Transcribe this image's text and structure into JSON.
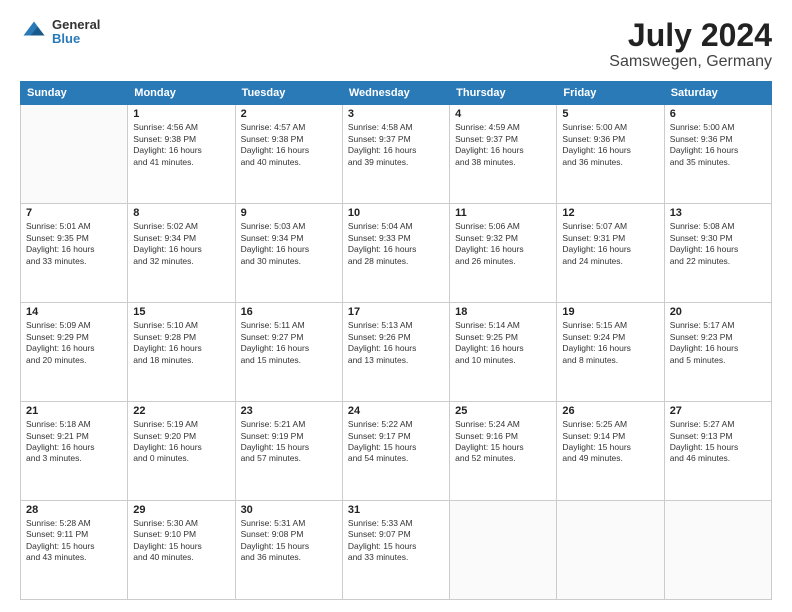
{
  "logo": {
    "line1": "General",
    "line2": "Blue"
  },
  "title": "July 2024",
  "subtitle": "Samswegen, Germany",
  "weekdays": [
    "Sunday",
    "Monday",
    "Tuesday",
    "Wednesday",
    "Thursday",
    "Friday",
    "Saturday"
  ],
  "weeks": [
    [
      {
        "day": "",
        "info": ""
      },
      {
        "day": "1",
        "info": "Sunrise: 4:56 AM\nSunset: 9:38 PM\nDaylight: 16 hours\nand 41 minutes."
      },
      {
        "day": "2",
        "info": "Sunrise: 4:57 AM\nSunset: 9:38 PM\nDaylight: 16 hours\nand 40 minutes."
      },
      {
        "day": "3",
        "info": "Sunrise: 4:58 AM\nSunset: 9:37 PM\nDaylight: 16 hours\nand 39 minutes."
      },
      {
        "day": "4",
        "info": "Sunrise: 4:59 AM\nSunset: 9:37 PM\nDaylight: 16 hours\nand 38 minutes."
      },
      {
        "day": "5",
        "info": "Sunrise: 5:00 AM\nSunset: 9:36 PM\nDaylight: 16 hours\nand 36 minutes."
      },
      {
        "day": "6",
        "info": "Sunrise: 5:00 AM\nSunset: 9:36 PM\nDaylight: 16 hours\nand 35 minutes."
      }
    ],
    [
      {
        "day": "7",
        "info": "Sunrise: 5:01 AM\nSunset: 9:35 PM\nDaylight: 16 hours\nand 33 minutes."
      },
      {
        "day": "8",
        "info": "Sunrise: 5:02 AM\nSunset: 9:34 PM\nDaylight: 16 hours\nand 32 minutes."
      },
      {
        "day": "9",
        "info": "Sunrise: 5:03 AM\nSunset: 9:34 PM\nDaylight: 16 hours\nand 30 minutes."
      },
      {
        "day": "10",
        "info": "Sunrise: 5:04 AM\nSunset: 9:33 PM\nDaylight: 16 hours\nand 28 minutes."
      },
      {
        "day": "11",
        "info": "Sunrise: 5:06 AM\nSunset: 9:32 PM\nDaylight: 16 hours\nand 26 minutes."
      },
      {
        "day": "12",
        "info": "Sunrise: 5:07 AM\nSunset: 9:31 PM\nDaylight: 16 hours\nand 24 minutes."
      },
      {
        "day": "13",
        "info": "Sunrise: 5:08 AM\nSunset: 9:30 PM\nDaylight: 16 hours\nand 22 minutes."
      }
    ],
    [
      {
        "day": "14",
        "info": "Sunrise: 5:09 AM\nSunset: 9:29 PM\nDaylight: 16 hours\nand 20 minutes."
      },
      {
        "day": "15",
        "info": "Sunrise: 5:10 AM\nSunset: 9:28 PM\nDaylight: 16 hours\nand 18 minutes."
      },
      {
        "day": "16",
        "info": "Sunrise: 5:11 AM\nSunset: 9:27 PM\nDaylight: 16 hours\nand 15 minutes."
      },
      {
        "day": "17",
        "info": "Sunrise: 5:13 AM\nSunset: 9:26 PM\nDaylight: 16 hours\nand 13 minutes."
      },
      {
        "day": "18",
        "info": "Sunrise: 5:14 AM\nSunset: 9:25 PM\nDaylight: 16 hours\nand 10 minutes."
      },
      {
        "day": "19",
        "info": "Sunrise: 5:15 AM\nSunset: 9:24 PM\nDaylight: 16 hours\nand 8 minutes."
      },
      {
        "day": "20",
        "info": "Sunrise: 5:17 AM\nSunset: 9:23 PM\nDaylight: 16 hours\nand 5 minutes."
      }
    ],
    [
      {
        "day": "21",
        "info": "Sunrise: 5:18 AM\nSunset: 9:21 PM\nDaylight: 16 hours\nand 3 minutes."
      },
      {
        "day": "22",
        "info": "Sunrise: 5:19 AM\nSunset: 9:20 PM\nDaylight: 16 hours\nand 0 minutes."
      },
      {
        "day": "23",
        "info": "Sunrise: 5:21 AM\nSunset: 9:19 PM\nDaylight: 15 hours\nand 57 minutes."
      },
      {
        "day": "24",
        "info": "Sunrise: 5:22 AM\nSunset: 9:17 PM\nDaylight: 15 hours\nand 54 minutes."
      },
      {
        "day": "25",
        "info": "Sunrise: 5:24 AM\nSunset: 9:16 PM\nDaylight: 15 hours\nand 52 minutes."
      },
      {
        "day": "26",
        "info": "Sunrise: 5:25 AM\nSunset: 9:14 PM\nDaylight: 15 hours\nand 49 minutes."
      },
      {
        "day": "27",
        "info": "Sunrise: 5:27 AM\nSunset: 9:13 PM\nDaylight: 15 hours\nand 46 minutes."
      }
    ],
    [
      {
        "day": "28",
        "info": "Sunrise: 5:28 AM\nSunset: 9:11 PM\nDaylight: 15 hours\nand 43 minutes."
      },
      {
        "day": "29",
        "info": "Sunrise: 5:30 AM\nSunset: 9:10 PM\nDaylight: 15 hours\nand 40 minutes."
      },
      {
        "day": "30",
        "info": "Sunrise: 5:31 AM\nSunset: 9:08 PM\nDaylight: 15 hours\nand 36 minutes."
      },
      {
        "day": "31",
        "info": "Sunrise: 5:33 AM\nSunset: 9:07 PM\nDaylight: 15 hours\nand 33 minutes."
      },
      {
        "day": "",
        "info": ""
      },
      {
        "day": "",
        "info": ""
      },
      {
        "day": "",
        "info": ""
      }
    ]
  ]
}
